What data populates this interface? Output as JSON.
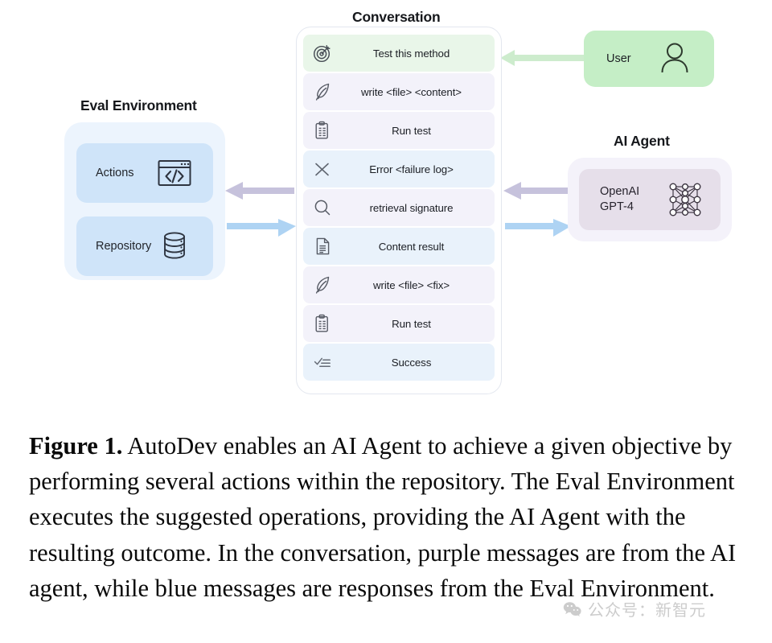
{
  "figure": {
    "caption_label": "Figure 1.",
    "caption_body": " AutoDev enables an AI Agent to achieve a given objective by performing several actions within the repository. The Eval Environment executes the suggested operations, providing the AI Agent with the resulting outcome. In the conversation, purple messages are from the AI agent, while blue messages are responses from the Eval Environment."
  },
  "eval_environment": {
    "title": "Eval Environment",
    "boxes": [
      {
        "label": "Actions",
        "icon": "code-window-icon"
      },
      {
        "label": "Repository",
        "icon": "database-icon"
      }
    ]
  },
  "conversation": {
    "title": "Conversation",
    "messages": [
      {
        "text": "Test this method",
        "icon": "target-icon",
        "source": "user"
      },
      {
        "text": "write <file> <content>",
        "icon": "quill-pen-icon",
        "source": "agent"
      },
      {
        "text": "Run test",
        "icon": "clipboard-icon",
        "source": "agent"
      },
      {
        "text": "Error <failure log>",
        "icon": "x-cross-icon",
        "source": "env"
      },
      {
        "text": "retrieval signature",
        "icon": "magnifier-icon",
        "source": "agent"
      },
      {
        "text": "Content result",
        "icon": "document-icon",
        "source": "env"
      },
      {
        "text": "write <file> <fix>",
        "icon": "quill-pen-icon",
        "source": "agent"
      },
      {
        "text": "Run test",
        "icon": "clipboard-icon",
        "source": "agent"
      },
      {
        "text": "Success",
        "icon": "checklist-icon",
        "source": "env"
      }
    ]
  },
  "user": {
    "label": "User",
    "icon": "person-icon"
  },
  "ai_agent": {
    "title": "AI Agent",
    "model_label": "OpenAI\nGPT-4",
    "icon": "neural-network-icon"
  },
  "watermark": {
    "text": "公众号：新智元",
    "icon": "wechat-logo-icon"
  },
  "colors": {
    "user_green": "#c5eec6",
    "message_user": "#e9f6e9",
    "message_agent": "#f3f2fa",
    "message_env": "#e9f2fb",
    "eval_outer": "#ecf4fd",
    "eval_inner": "#cfe4f9",
    "agent_outer": "#f4f2fa",
    "agent_inner": "#e6dfea",
    "arrow_agent": "#c6c2dc",
    "arrow_env": "#aed3f3",
    "arrow_user": "#cdeccd"
  }
}
